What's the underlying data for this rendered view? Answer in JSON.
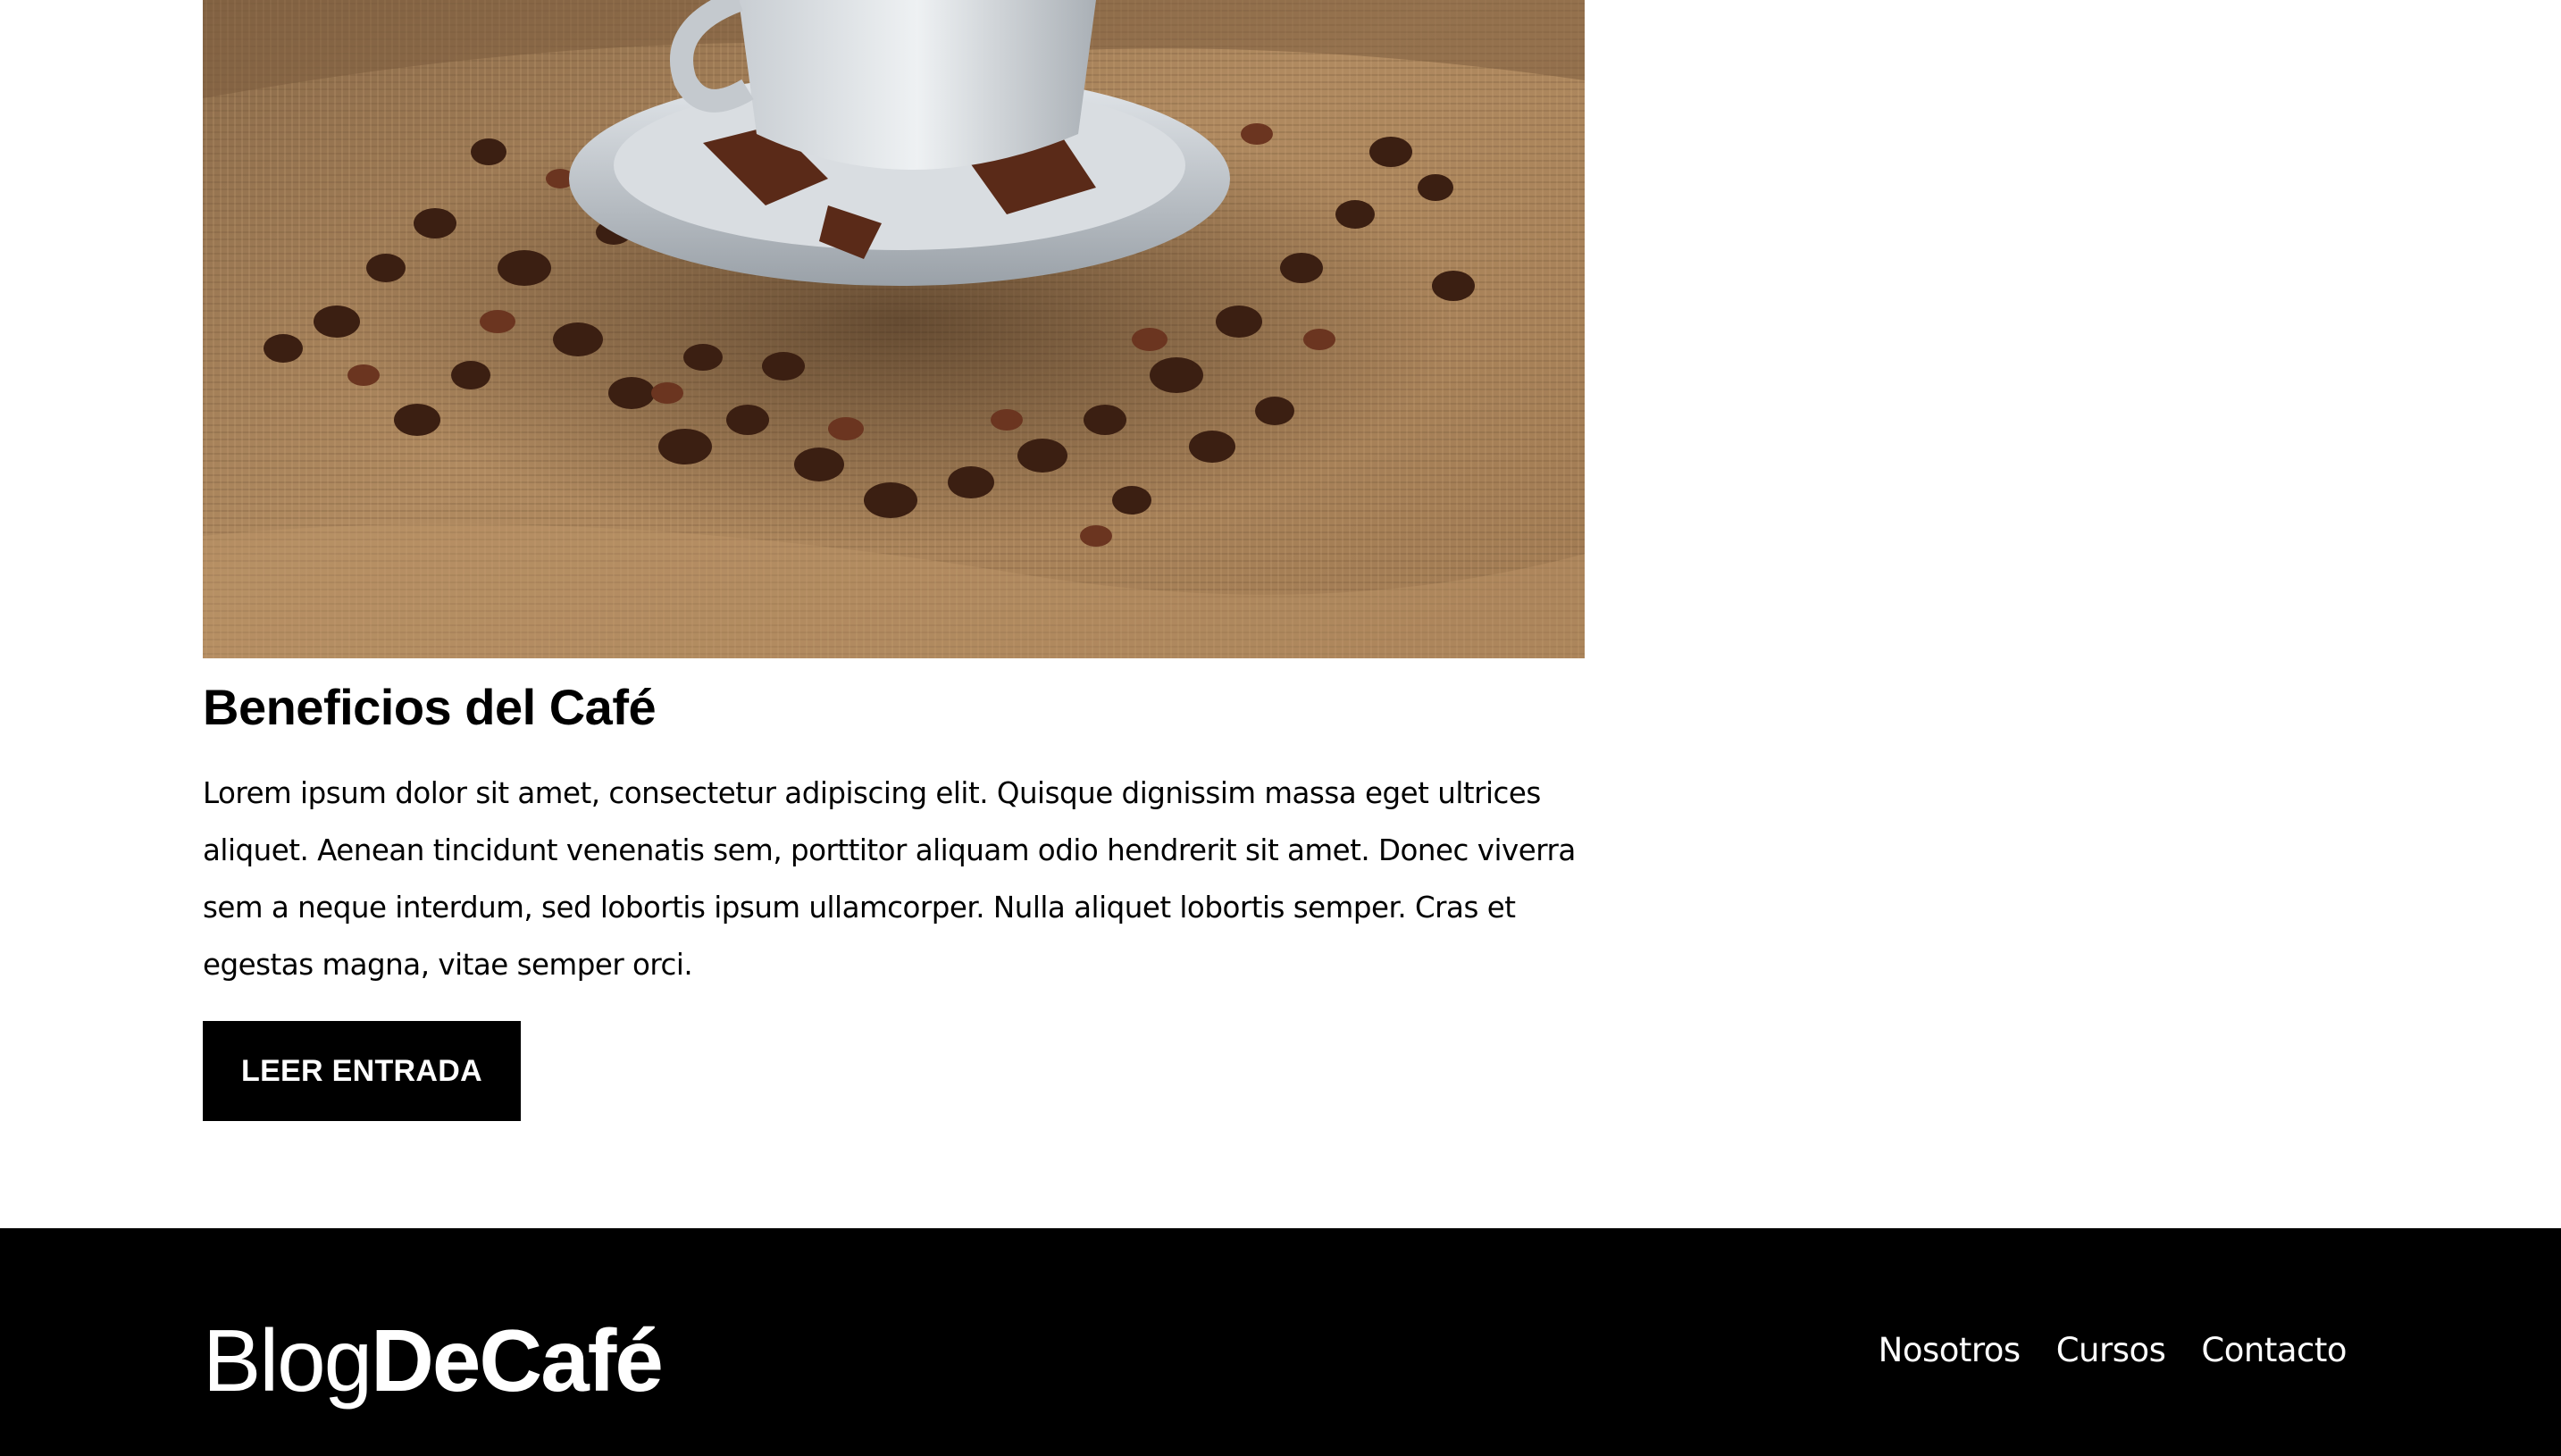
{
  "post": {
    "image_alt": "Taza de café sobre arpillera con granos de café y especias",
    "title": "Beneficios del Café",
    "excerpt": "Lorem ipsum dolor sit amet, consectetur adipiscing elit. Quisque dignissim massa eget ultrices aliquet. Aenean tincidunt venenatis sem, porttitor aliquam odio hendrerit sit amet. Donec viverra sem a neque interdum, sed lobortis ipsum ullamcorper. Nulla aliquet lobortis semper. Cras et egestas magna, vitae semper orci.",
    "button_label": "LEER ENTRADA"
  },
  "footer": {
    "logo_light": "Blog",
    "logo_bold": "DeCafé",
    "nav": [
      {
        "label": "Nosotros"
      },
      {
        "label": "Cursos"
      },
      {
        "label": "Contacto"
      }
    ]
  },
  "colors": {
    "background": "#ffffff",
    "text": "#000000",
    "footer_background": "#000000",
    "button_background": "#000000",
    "button_text": "#ffffff"
  }
}
